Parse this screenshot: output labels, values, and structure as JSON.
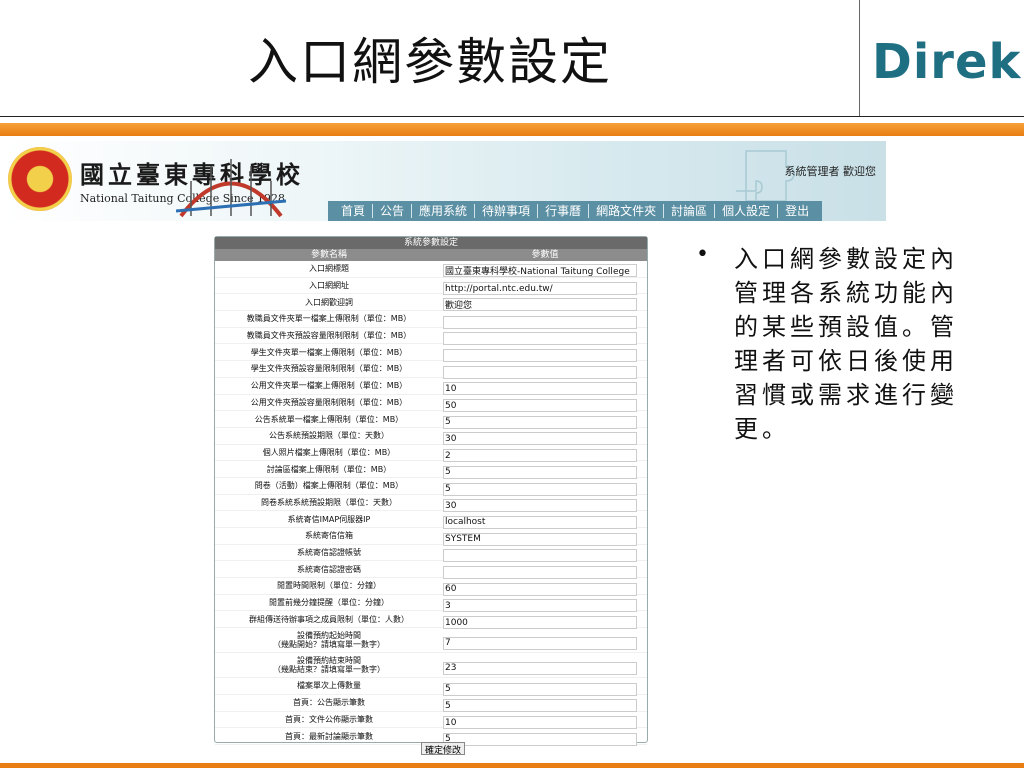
{
  "slide": {
    "title": "入口網參數設定",
    "logo": "Direk",
    "note": "入口網參數設定內管理各系統功能內的某些預設值。管理者可依日後使用習慣或需求進行變更。",
    "bullet": "•"
  },
  "portal": {
    "school_name_zh": "國立臺東專科學校",
    "school_name_en": "National Taitung College Since 1928",
    "welcome": "系統管理者 歡迎您",
    "nav": [
      "首頁",
      "公告",
      "應用系統",
      "待辦事項",
      "行事曆",
      "網路文件夾",
      "討論區",
      "個人設定",
      "登出"
    ]
  },
  "settings": {
    "title": "系統參數設定",
    "col_name": "參數名稱",
    "col_value": "參數值",
    "submit": "確定修改",
    "rows": [
      {
        "name": "入口網標題",
        "value": "國立臺東專科學校-National Taitung College"
      },
      {
        "name": "入口網網址",
        "value": "http://portal.ntc.edu.tw/"
      },
      {
        "name": "入口網歡迎詞",
        "value": "歡迎您"
      },
      {
        "name": "教職員文件夾單一檔案上傳限制（單位：MB）",
        "value": ""
      },
      {
        "name": "教職員文件夾預設容量限制限制（單位：MB）",
        "value": ""
      },
      {
        "name": "學生文件夾單一檔案上傳限制（單位：MB）",
        "value": ""
      },
      {
        "name": "學生文件夾預設容量限制限制（單位：MB）",
        "value": ""
      },
      {
        "name": "公用文件夾單一檔案上傳限制（單位：MB）",
        "value": "10"
      },
      {
        "name": "公用文件夾預設容量限制限制（單位：MB）",
        "value": "50"
      },
      {
        "name": "公告系統單一檔案上傳限制（單位：MB）",
        "value": "5"
      },
      {
        "name": "公告系統預設期限（單位：天數）",
        "value": "30"
      },
      {
        "name": "個人照片檔案上傳限制（單位：MB）",
        "value": "2"
      },
      {
        "name": "討論區檔案上傳限制（單位：MB）",
        "value": "5"
      },
      {
        "name": "問卷（活動）檔案上傳限制（單位：MB）",
        "value": "5"
      },
      {
        "name": "問卷系統系統預設期限（單位：天數）",
        "value": "30"
      },
      {
        "name": "系統寄信IMAP伺服器IP",
        "value": "localhost"
      },
      {
        "name": "系統寄信信箱",
        "value": "SYSTEM"
      },
      {
        "name": "系統寄信認證帳號",
        "value": ""
      },
      {
        "name": "系統寄信認證密碼",
        "value": ""
      },
      {
        "name": "閒置時間限制（單位：分鐘）",
        "value": "60"
      },
      {
        "name": "閒置前幾分鐘提醒（單位：分鐘）",
        "value": "3"
      },
      {
        "name": "群組傳送待辦事項之成員限制（單位：人數）",
        "value": "1000"
      },
      {
        "name": "設備預約起始時間\n（幾點開始？請填寫單一數字）",
        "value": "7",
        "tall": true
      },
      {
        "name": "設備預約結束時間\n（幾點結束？請填寫單一數字）",
        "value": "23",
        "tall": true
      },
      {
        "name": "檔案單次上傳數量",
        "value": "5"
      },
      {
        "name": "首頁：公告顯示筆數",
        "value": "5"
      },
      {
        "name": "首頁：文件公佈顯示筆數",
        "value": "10"
      },
      {
        "name": "首頁：最新討論顯示筆數",
        "value": "5"
      }
    ]
  },
  "colors": {
    "accent_orange": "#e87d12",
    "logo_teal": "#1f6f83",
    "nav_bg": "#5b8fa3"
  }
}
